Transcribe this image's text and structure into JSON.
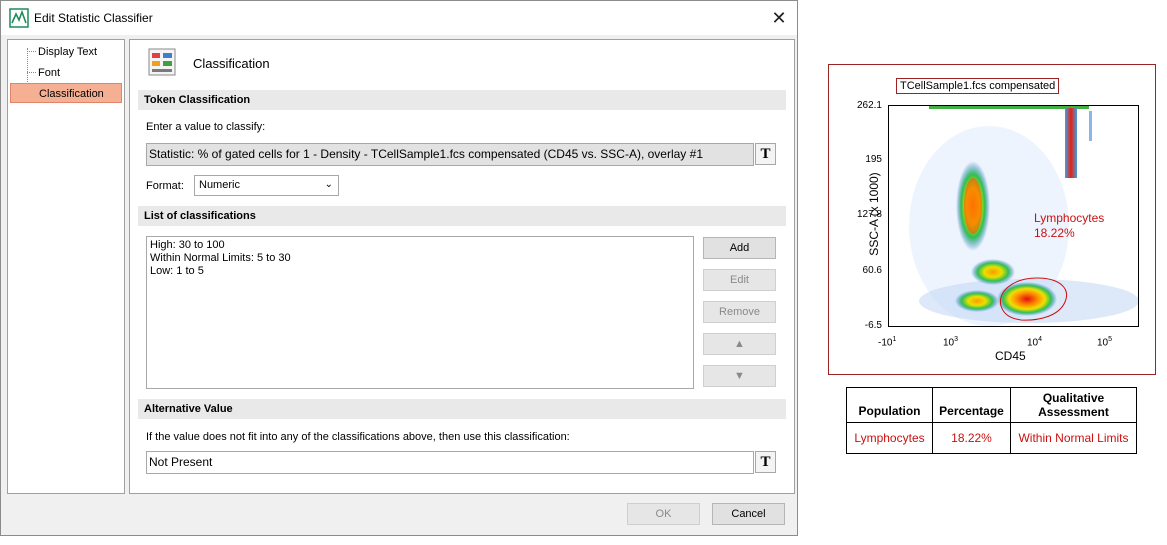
{
  "dialog": {
    "title": "Edit Statistic Classifier",
    "close_glyph": "✕",
    "nav": [
      "Display Text",
      "Font",
      "Classification"
    ],
    "selected_nav": "Classification",
    "page_title": "Classification",
    "token_section": {
      "header": "Token Classification",
      "prompt": "Enter a value to classify:",
      "value": "Statistic: % of gated cells for 1 - Density - TCellSample1.fcs compensated (CD45 vs. SSC-A), overlay #1",
      "format_label": "Format:",
      "format_value": "Numeric"
    },
    "list_section": {
      "header": "List of classifications",
      "items": [
        "High: 30 to 100",
        "Within Normal Limits: 5 to 30",
        "Low: 1 to 5"
      ],
      "buttons": {
        "add": "Add",
        "edit": "Edit",
        "remove": "Remove",
        "up": "▲",
        "down": "▼"
      }
    },
    "alt_section": {
      "header": "Alternative Value",
      "description": "If the value does not fit into any of the classifications above, then use this classification:",
      "value": "Not Present"
    },
    "ok_label": "OK",
    "cancel_label": "Cancel",
    "token_button_glyph": "T"
  },
  "plot": {
    "title": "TCellSample1.fcs compensated",
    "y_ticks": [
      "262.1",
      "195",
      "127.8",
      "60.6",
      "-6.5"
    ],
    "x_ticks": [
      {
        "prefix": "-10",
        "exp": "1"
      },
      {
        "prefix": "10",
        "exp": "3"
      },
      {
        "prefix": "10",
        "exp": "4"
      },
      {
        "prefix": "10",
        "exp": "5"
      }
    ],
    "xlabel": "CD45",
    "ylabel": "SSC-A (x 1000)",
    "gate_name": "Lymphocytes",
    "gate_pct": "18.22%",
    "colors": {
      "frame": "#9b2323",
      "gate": "#cc1010"
    }
  },
  "table": {
    "headers": [
      "Population",
      "Percentage",
      "Qualitative Assessment"
    ],
    "row": [
      "Lymphocytes",
      "18.22%",
      "Within Normal Limits"
    ]
  }
}
